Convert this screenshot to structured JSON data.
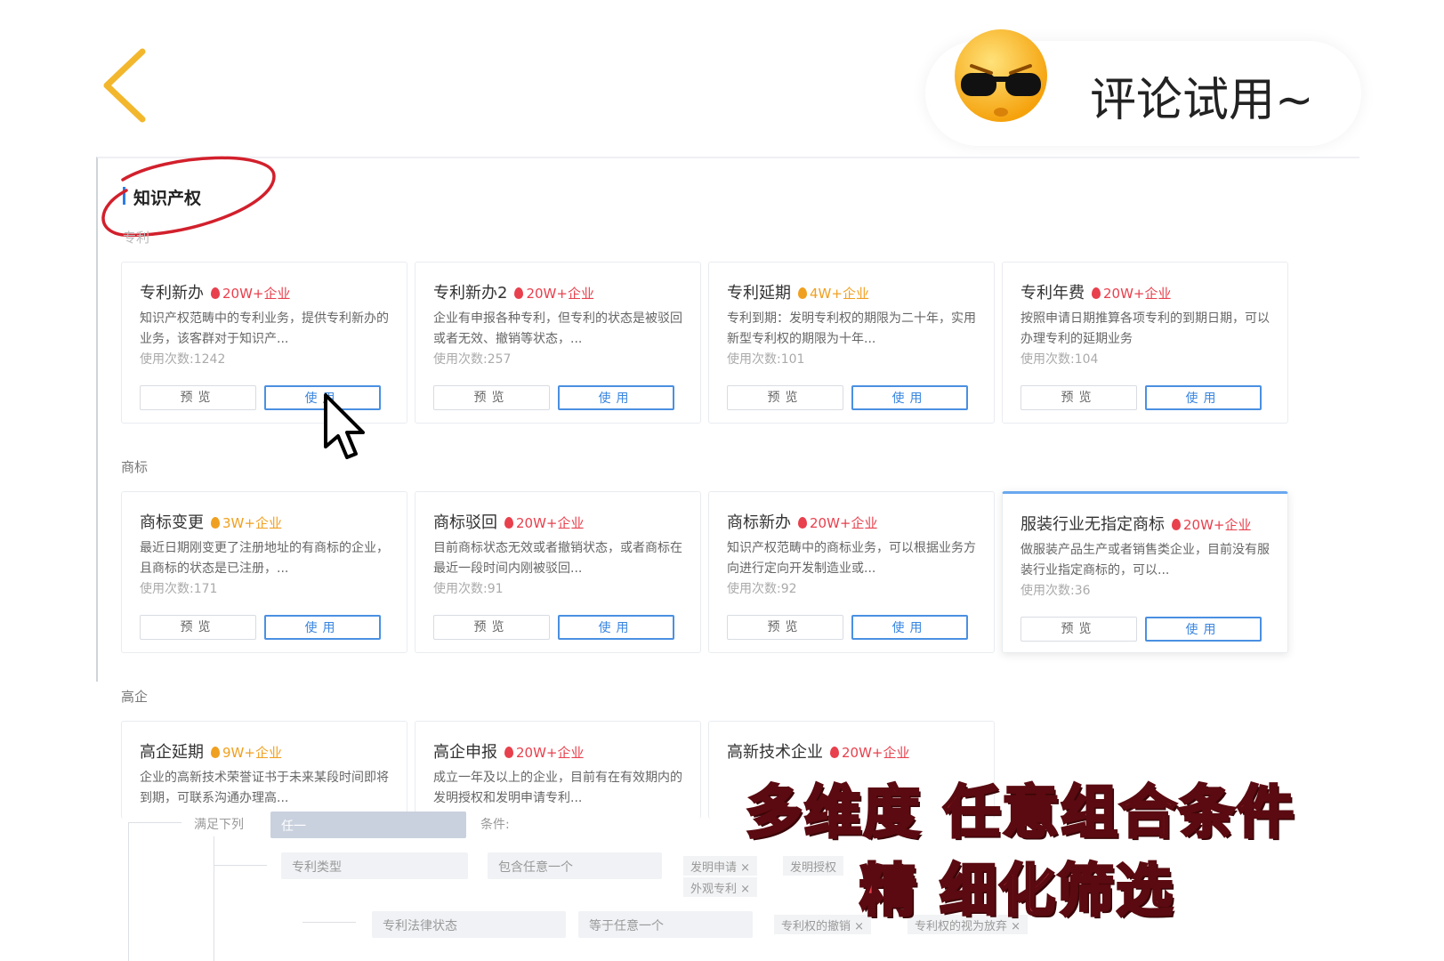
{
  "header": {
    "comment_text": "评论试用~"
  },
  "section": {
    "title": "知识产权"
  },
  "groups": {
    "patent": "专利",
    "trademark": "商标",
    "hightech": "高企"
  },
  "cards": [
    {
      "title": "专利新办",
      "hot": "20W+企业",
      "hot_color": "#e8404d",
      "desc": "知识产权范畴中的专利业务，提供专利新办的业务，该客群对于知识产...",
      "usage": "使用次数:1242",
      "preview": "预览",
      "use": "使用"
    },
    {
      "title": "专利新办2",
      "hot": "20W+企业",
      "hot_color": "#e8404d",
      "desc": "企业有申报各种专利，但专利的状态是被驳回或者无效、撤销等状态，...",
      "usage": "使用次数:257",
      "preview": "预览",
      "use": "使用"
    },
    {
      "title": "专利延期",
      "hot": "4W+企业",
      "hot_color": "#f0a020",
      "desc": "专利到期：发明专利权的期限为二十年，实用新型专利权的期限为十年...",
      "usage": "使用次数:101",
      "preview": "预览",
      "use": "使用"
    },
    {
      "title": "专利年费",
      "hot": "20W+企业",
      "hot_color": "#e8404d",
      "desc": "按照申请日期推算各项专利的到期日期，可以办理专利的延期业务",
      "usage": "使用次数:104",
      "preview": "预览",
      "use": "使用"
    },
    {
      "title": "商标变更",
      "hot": "3W+企业",
      "hot_color": "#f0a020",
      "desc": "最近日期刚变更了注册地址的有商标的企业，且商标的状态是已注册，...",
      "usage": "使用次数:171",
      "preview": "预览",
      "use": "使用"
    },
    {
      "title": "商标驳回",
      "hot": "20W+企业",
      "hot_color": "#e8404d",
      "desc": "目前商标状态无效或者撤销状态，或者商标在最近一段时间内刚被驳回...",
      "usage": "使用次数:91",
      "preview": "预览",
      "use": "使用"
    },
    {
      "title": "商标新办",
      "hot": "20W+企业",
      "hot_color": "#e8404d",
      "desc": "知识产权范畴中的商标业务，可以根据业务方向进行定向开发制造业或...",
      "usage": "使用次数:92",
      "preview": "预览",
      "use": "使用"
    },
    {
      "title": "服装行业无指定商标",
      "hot": "20W+企业",
      "hot_color": "#e8404d",
      "desc": "做服装产品生产或者销售类企业，目前没有服装行业指定商标的，可以...",
      "usage": "使用次数:36",
      "preview": "预览",
      "use": "使用"
    },
    {
      "title": "高企延期",
      "hot": "9W+企业",
      "hot_color": "#f0a020",
      "desc": "企业的高新技术荣誉证书于未来某段时间即将到期，可联系沟通办理高...",
      "usage": "",
      "preview": "",
      "use": ""
    },
    {
      "title": "高企申报",
      "hot": "20W+企业",
      "hot_color": "#e8404d",
      "desc": "成立一年及以上的企业，目前有在有效期内的发明授权和发明申请专利...",
      "usage": "",
      "preview": "",
      "use": ""
    },
    {
      "title": "高新技术企业",
      "hot": "20W+企业",
      "hot_color": "#e8404d",
      "desc": "",
      "usage": "",
      "preview": "",
      "use": ""
    }
  ],
  "filter": {
    "match_label": "满足下列",
    "match_value": "任一",
    "condition_label": "条件:",
    "row1_field": "专利类型",
    "row1_op": "包含任意一个",
    "row1_tags": [
      "发明申请 ×",
      "发明授权",
      "外观专利 ×"
    ],
    "row2_field": "专利法律状态",
    "row2_op": "等于任意一个",
    "row2_tags": [
      "专利权的撤销 ×",
      "专利权的视为放弃 ×"
    ]
  },
  "captions": {
    "line1": "多维度 任意组合条件",
    "line2": "精 细化筛选"
  },
  "colors": {
    "accent_blue": "#4a90e2",
    "hot_red": "#e8404d",
    "hot_orange": "#f0a020",
    "back_chevron": "#f3b72d"
  }
}
